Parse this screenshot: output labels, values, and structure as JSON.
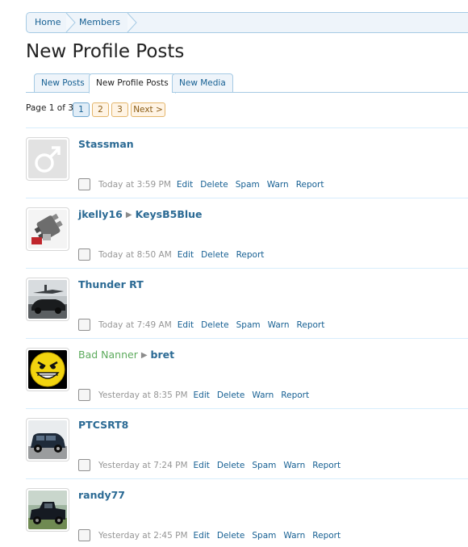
{
  "breadcrumb": {
    "home": "Home",
    "members": "Members"
  },
  "page_title": "New Profile Posts",
  "tabs": [
    {
      "label": "New Posts",
      "active": false
    },
    {
      "label": "New Profile Posts",
      "active": true
    },
    {
      "label": "New Media",
      "active": false
    }
  ],
  "pagination": {
    "info": "Page 1 of 3",
    "pages": [
      "1",
      "2",
      "3"
    ],
    "next": "Next >"
  },
  "posts": [
    {
      "author": "Stassman",
      "target": "",
      "time": "Today at 3:59 PM",
      "avatar": "default-male-icon",
      "actions": [
        "Edit",
        "Delete",
        "Spam",
        "Warn",
        "Report"
      ]
    },
    {
      "author": "jkelly16",
      "target": "KeysB5Blue",
      "time": "Today at 8:50 AM",
      "avatar": "engine-photo",
      "actions": [
        "Edit",
        "Delete",
        "Report"
      ]
    },
    {
      "author": "Thunder RT",
      "target": "",
      "time": "Today at 7:49 AM",
      "avatar": "car-airplane-photo",
      "actions": [
        "Edit",
        "Delete",
        "Spam",
        "Warn",
        "Report"
      ]
    },
    {
      "author": "Bad Nanner",
      "target": "bret",
      "time": "Yesterday at 8:35 PM",
      "avatar": "smiley-face",
      "actions": [
        "Edit",
        "Delete",
        "Warn",
        "Report"
      ]
    },
    {
      "author": "PTCSRT8",
      "target": "",
      "time": "Yesterday at 7:24 PM",
      "avatar": "suv-photo",
      "actions": [
        "Edit",
        "Delete",
        "Spam",
        "Warn",
        "Report"
      ]
    },
    {
      "author": "randy77",
      "target": "",
      "time": "Yesterday at 2:45 PM",
      "avatar": "truck-photo",
      "actions": [
        "Edit",
        "Delete",
        "Spam",
        "Warn",
        "Report"
      ]
    }
  ],
  "colors": {
    "link": "#176093",
    "username": "#2b6a94",
    "special_username": "#5dab5d",
    "time": "#969696",
    "border": "#a5cae4"
  }
}
